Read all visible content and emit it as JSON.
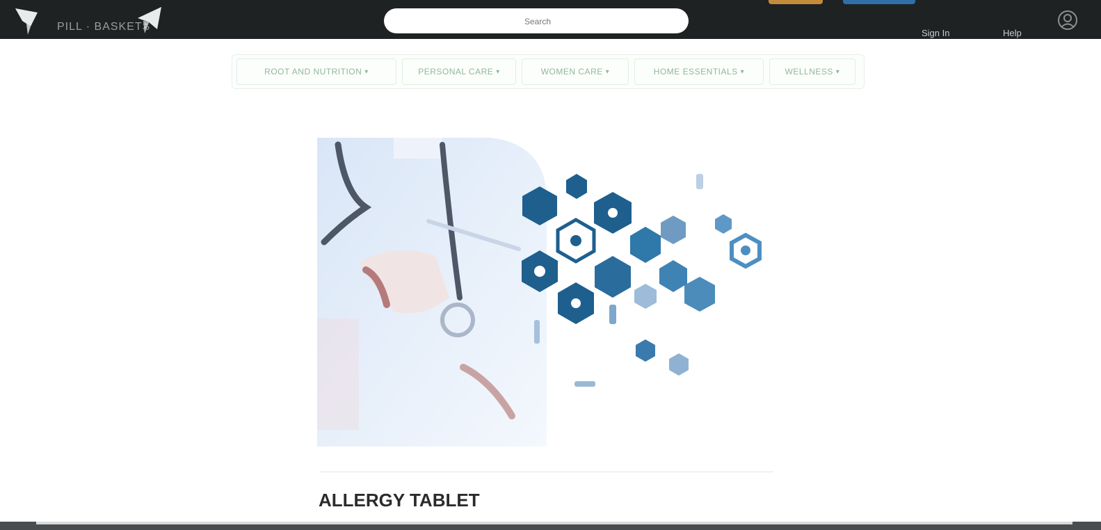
{
  "header": {
    "logo_text": "PILL · BASKETS",
    "search_placeholder": "Search",
    "link_signin": "Sign In",
    "link_help": "Help",
    "bg_color": "#1f2223"
  },
  "nav": {
    "items": [
      {
        "label": "ROOT AND NUTRITION"
      },
      {
        "label": "PERSONAL CARE"
      },
      {
        "label": "WOMEN CARE"
      },
      {
        "label": "HOME ESSENTIALS"
      },
      {
        "label": "WELLNESS"
      }
    ],
    "accent_color": "#8fb79a"
  },
  "hero": {
    "icon_color": "#1e5f8e"
  },
  "product": {
    "title": "ALLERGY TABLET"
  }
}
